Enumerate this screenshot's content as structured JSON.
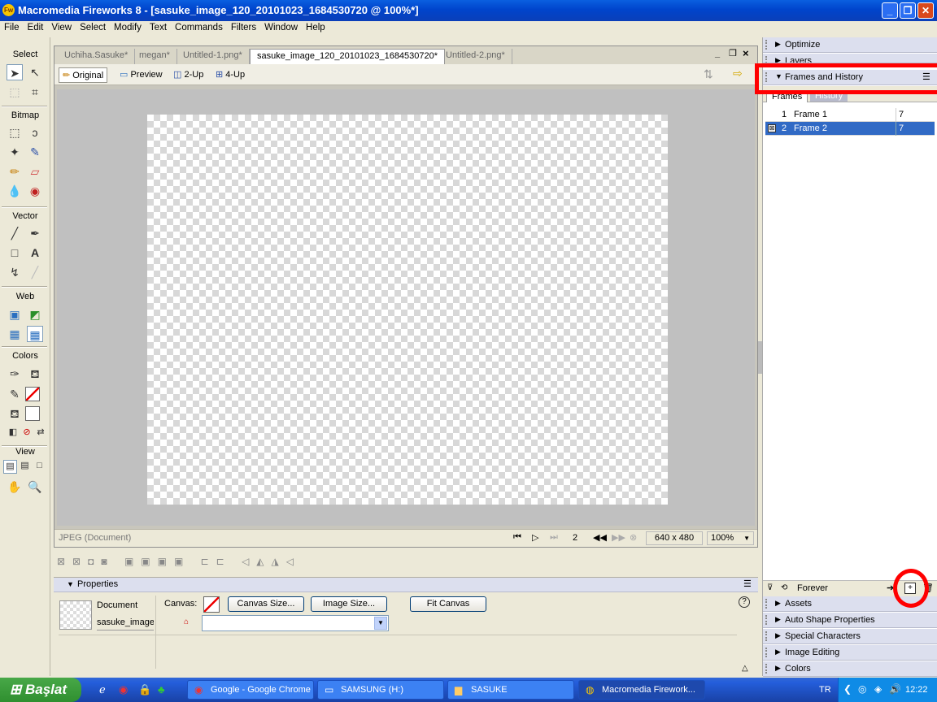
{
  "window": {
    "title": "Macromedia Fireworks 8 - [sasuke_image_120_20101023_1684530720 @ 100%*]",
    "app_icon": "Fw"
  },
  "menu": [
    "File",
    "Edit",
    "View",
    "Select",
    "Modify",
    "Text",
    "Commands",
    "Filters",
    "Window",
    "Help"
  ],
  "tools": {
    "sections": [
      "Select",
      "Bitmap",
      "Vector",
      "Web",
      "Colors",
      "View"
    ]
  },
  "document": {
    "tabs": [
      "Uchiha.Sasuke*",
      "megan*",
      "Untitled-1.png*",
      "sasuke_image_120_20101023_1684530720*",
      "Untitled-2.png*"
    ],
    "active_tab": 3,
    "view_modes": [
      "Original",
      "Preview",
      "2-Up",
      "4-Up"
    ],
    "status_format": "JPEG (Document)",
    "current_frame": "2",
    "canvas_size": "640 x 480",
    "zoom": "100%"
  },
  "properties": {
    "title": "Properties",
    "type_label": "Document",
    "doc_name": "sasuke_image_",
    "canvas_label": "Canvas:",
    "canvas_size_btn": "Canvas Size...",
    "image_size_btn": "Image Size...",
    "fit_canvas_btn": "Fit Canvas"
  },
  "panels": {
    "top": [
      "Optimize",
      "Layers"
    ],
    "frames_history": {
      "title": "Frames and History",
      "tabs": [
        "Frames",
        "History"
      ],
      "frames": [
        {
          "num": "1",
          "name": "Frame 1",
          "delay": "7"
        },
        {
          "num": "2",
          "name": "Frame 2",
          "delay": "7"
        }
      ],
      "loop_label": "Forever"
    },
    "bottom": [
      "Assets",
      "Auto Shape Properties",
      "Special Characters",
      "Image Editing",
      "Colors"
    ]
  },
  "taskbar": {
    "start": "Başlat",
    "buttons": [
      "Google - Google Chrome",
      "SAMSUNG (H:)",
      "SASUKE",
      "Macromedia Firework..."
    ],
    "lang": "TR",
    "clock": "12:22"
  },
  "colors": {
    "title_bar": "#0054e3",
    "selection": "#316ac5",
    "annotation": "#ff0000"
  }
}
